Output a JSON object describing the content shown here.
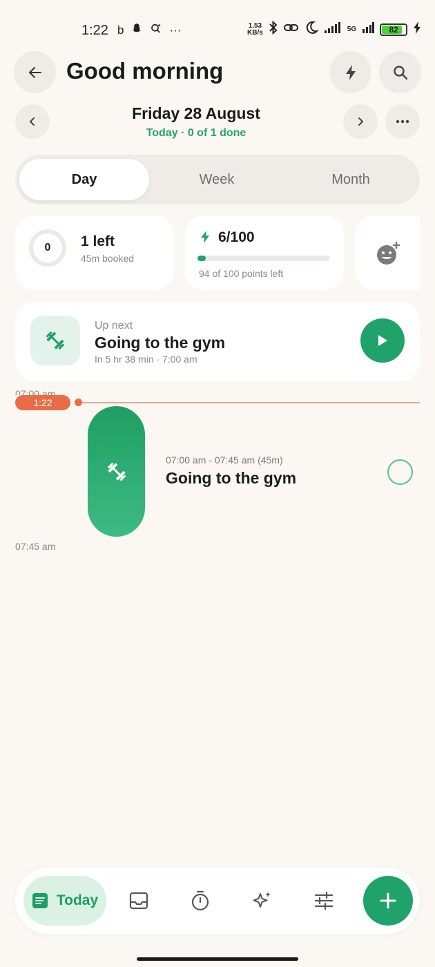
{
  "status_bar": {
    "time": "1:22",
    "net_speed_value": "1.53",
    "net_speed_unit": "KB/s",
    "network": "5G",
    "battery": "82"
  },
  "header": {
    "greeting": "Good morning"
  },
  "date_nav": {
    "title": "Friday 28 August",
    "subtitle": "Today · 0 of 1 done"
  },
  "tabs": [
    {
      "label": "Day",
      "active": true
    },
    {
      "label": "Week",
      "active": false
    },
    {
      "label": "Month",
      "active": false
    }
  ],
  "summary": {
    "ring_value": "0",
    "left_title": "1 left",
    "left_sub": "45m booked",
    "points_title": "6/100",
    "points_sub": "94 of 100 points left",
    "points_fraction": 0.06
  },
  "up_next": {
    "label": "Up next",
    "title": "Going to the gym",
    "subtitle": "In 5 hr 38 min · 7:00 am"
  },
  "timeline": {
    "start_label": "07:00 am",
    "now_label": "1:22",
    "end_label": "07:45 am",
    "task_time": "07:00 am - 07:45 am (45m)",
    "task_title": "Going to the gym"
  },
  "bottom_nav": {
    "today_label": "Today"
  },
  "colors": {
    "accent": "#1fa36a",
    "now": "#ea6c47",
    "background": "#fbf8f3"
  }
}
